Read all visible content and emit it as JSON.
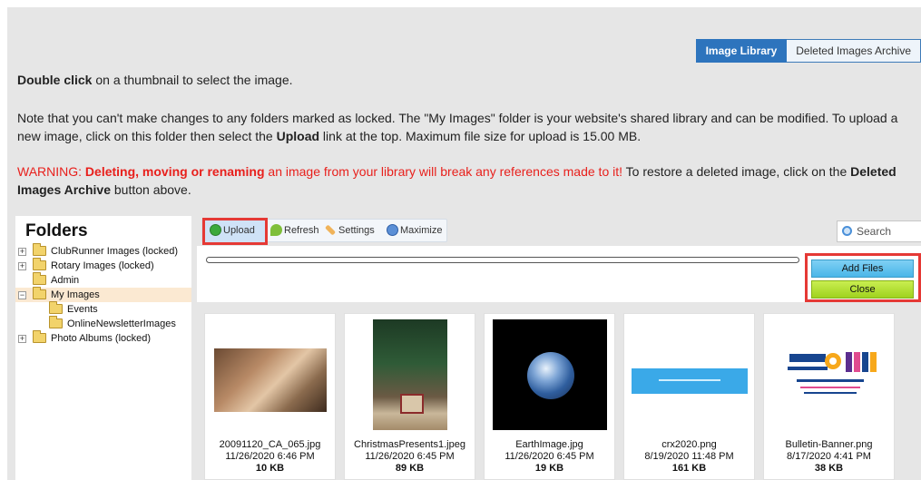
{
  "tabs": {
    "image_library": "Image Library",
    "deleted_archive": "Deleted Images Archive"
  },
  "intro": {
    "p1_bold": "Double click",
    "p1_rest": " on a thumbnail to select the image.",
    "p2_a": "Note that you can't make changes to any folders marked as locked. The \"My Images\" folder is your website's shared library and can be modified. To upload a new image, click on this folder then select the ",
    "p2_bold": "Upload",
    "p2_b": " link at the top. Maximum file size for upload is 15.00 MB.",
    "p3_warn": "WARNING: ",
    "p3_warn_bold": "Deleting, moving or renaming",
    "p3_warn_rest": " an image from your library will break any references made to it!",
    "p3_rest": " To restore a deleted image, click on the ",
    "p3_bold": "Deleted Images Archive",
    "p3_end": " button above."
  },
  "folders": {
    "title": "Folders",
    "items": [
      {
        "label": "ClubRunner Images (locked)",
        "expander": "+"
      },
      {
        "label": "Rotary Images (locked)",
        "expander": "+"
      },
      {
        "label": "Admin",
        "expander": ""
      },
      {
        "label": "My Images",
        "expander": "−"
      },
      {
        "label": "Events",
        "expander": ""
      },
      {
        "label": "OnlineNewsletterImages",
        "expander": ""
      },
      {
        "label": "Photo Albums (locked)",
        "expander": "+"
      }
    ]
  },
  "toolbar": {
    "upload": "Upload",
    "refresh": "Refresh",
    "settings": "Settings",
    "maximize": "Maximize",
    "search": "Search"
  },
  "upload_panel": {
    "progress": 0,
    "add_files": "Add Files",
    "close": "Close"
  },
  "thumbnails": [
    {
      "name": "20091120_CA_065.jpg",
      "date": "11/26/2020 6:46 PM",
      "size": "10 KB"
    },
    {
      "name": "ChristmasPresents1.jpeg",
      "date": "11/26/2020 6:45 PM",
      "size": "89 KB"
    },
    {
      "name": "EarthImage.jpg",
      "date": "11/26/2020 6:45 PM",
      "size": "19 KB"
    },
    {
      "name": "crx2020.png",
      "date": "8/19/2020 11:48 PM",
      "size": "161 KB"
    },
    {
      "name": "Bulletin-Banner.png",
      "date": "8/17/2020 4:41 PM",
      "size": "38 KB"
    }
  ],
  "colors": {
    "accent": "#2d74bd",
    "warning": "#e8201c",
    "highlight": "#e53935"
  }
}
